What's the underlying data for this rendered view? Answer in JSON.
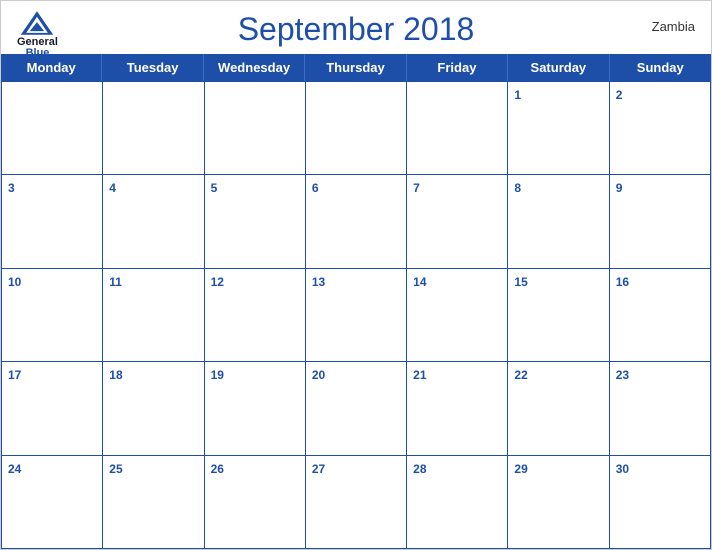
{
  "header": {
    "logo": {
      "general": "General",
      "blue": "Blue"
    },
    "title": "September 2018",
    "country": "Zambia"
  },
  "days": [
    "Monday",
    "Tuesday",
    "Wednesday",
    "Thursday",
    "Friday",
    "Saturday",
    "Sunday"
  ],
  "weeks": [
    [
      null,
      null,
      null,
      null,
      null,
      1,
      2
    ],
    [
      3,
      4,
      5,
      6,
      7,
      8,
      9
    ],
    [
      10,
      11,
      12,
      13,
      14,
      15,
      16
    ],
    [
      17,
      18,
      19,
      20,
      21,
      22,
      23
    ],
    [
      24,
      25,
      26,
      27,
      28,
      29,
      30
    ]
  ],
  "colors": {
    "blue": "#1e4fa8",
    "header_text": "#ffffff"
  }
}
